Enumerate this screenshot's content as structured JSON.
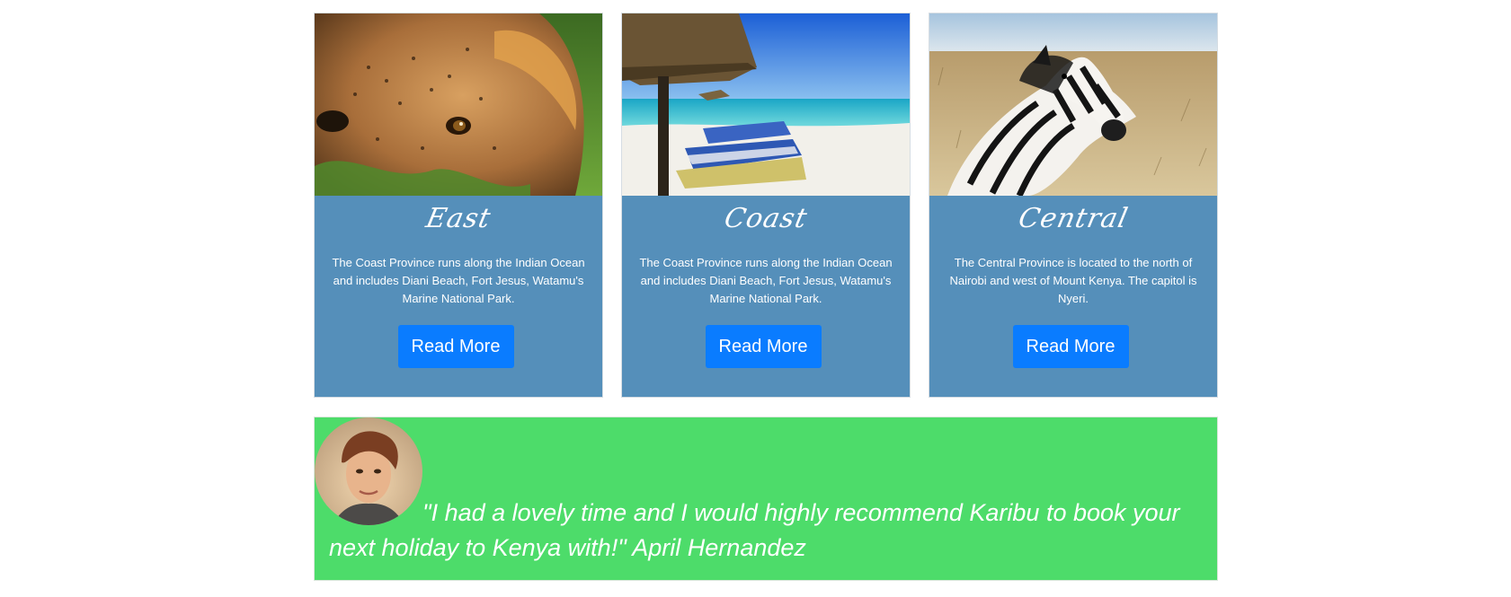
{
  "cards": [
    {
      "title": "East",
      "image": "lion-photo",
      "text": "The Coast Province runs along the Indian Ocean and includes Diani Beach, Fort Jesus, Watamu's Marine National Park.",
      "button": "Read More"
    },
    {
      "title": "Coast",
      "image": "beach-photo",
      "text": "The Coast Province runs along the Indian Ocean and includes Diani Beach, Fort Jesus, Watamu's Marine National Park.",
      "button": "Read More"
    },
    {
      "title": "Central",
      "image": "zebra-photo",
      "text": "The Central Province is located to the north of Nairobi and west of Mount Kenya. The capitol is Nyeri.",
      "button": "Read More"
    }
  ],
  "testimonial": {
    "avatar": "person-photo",
    "quote": "\"I had a lovely time and I would highly recommend Karibu to book your next holiday to Kenya with!\" April Hernandez"
  },
  "colors": {
    "card_bg": "#558fba",
    "button_bg": "#0a7cff",
    "testimonial_bg": "#4ddc6a"
  }
}
